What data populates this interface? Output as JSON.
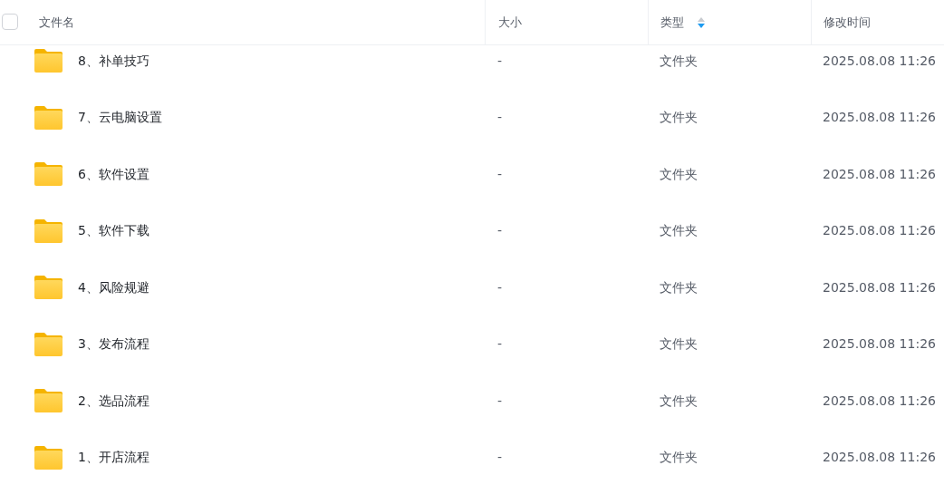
{
  "header": {
    "select_all": {
      "checked": false
    },
    "columns": [
      {
        "label": "文件名",
        "sorted": false
      },
      {
        "label": "大小",
        "sorted": false
      },
      {
        "label": "类型",
        "sorted": true,
        "descending": true
      },
      {
        "label": "修改时间",
        "sorted": false
      }
    ]
  },
  "rows": [
    {
      "name": "8、补单技巧",
      "size": "-",
      "type": "文件夹",
      "modified": "2025.08.08 11:26"
    },
    {
      "name": "7、云电脑设置",
      "size": "-",
      "type": "文件夹",
      "modified": "2025.08.08 11:26"
    },
    {
      "name": "6、软件设置",
      "size": "-",
      "type": "文件夹",
      "modified": "2025.08.08 11:26"
    },
    {
      "name": "5、软件下载",
      "size": "-",
      "type": "文件夹",
      "modified": "2025.08.08 11:26"
    },
    {
      "name": "4、风险规避",
      "size": "-",
      "type": "文件夹",
      "modified": "2025.08.08 11:26"
    },
    {
      "name": "3、发布流程",
      "size": "-",
      "type": "文件夹",
      "modified": "2025.08.08 11:26"
    },
    {
      "name": "2、选品流程",
      "size": "-",
      "type": "文件夹",
      "modified": "2025.08.08 11:26"
    },
    {
      "name": "1、开店流程",
      "size": "-",
      "type": "文件夹",
      "modified": "2025.08.08 11:26"
    }
  ]
}
